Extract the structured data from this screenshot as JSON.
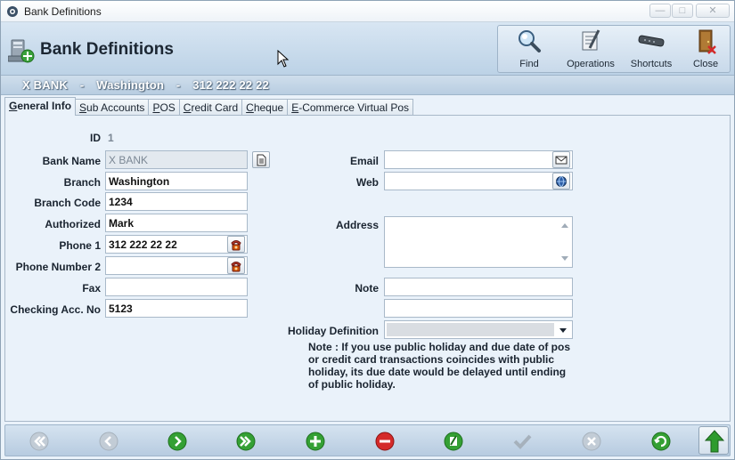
{
  "window": {
    "title": "Bank Definitions"
  },
  "header": {
    "title": "Bank Definitions",
    "toolbar": [
      {
        "label": "Find",
        "icon": "magnifier-icon"
      },
      {
        "label": "Operations",
        "icon": "operations-icon"
      },
      {
        "label": "Shortcuts",
        "icon": "shortcuts-icon"
      },
      {
        "label": "Close",
        "icon": "exit-door-icon"
      }
    ]
  },
  "record": {
    "name": "X BANK",
    "sep1": "-",
    "branch": "Washington",
    "sep2": "-",
    "phone": "312 222 22 22"
  },
  "tabs": [
    {
      "underlined": "G",
      "rest": "eneral Info",
      "active": true
    },
    {
      "underlined": "S",
      "rest": "ub Accounts",
      "active": false
    },
    {
      "underlined": "P",
      "rest": "OS",
      "active": false
    },
    {
      "underlined": "C",
      "rest": "redit Card",
      "active": false
    },
    {
      "underlined": "C",
      "rest": "heque",
      "active": false
    },
    {
      "underlined": "E",
      "rest": "-Commerce Virtual Pos",
      "active": false
    }
  ],
  "form": {
    "id_label": "ID",
    "id_value": "1",
    "bank_name_label": "Bank Name",
    "bank_name_value": "X BANK",
    "branch_label": "Branch",
    "branch_value": "Washington",
    "branch_code_label": "Branch Code",
    "branch_code_value": "1234",
    "authorized_label": "Authorized",
    "authorized_value": "Mark",
    "phone1_label": "Phone 1",
    "phone1_value": "312 222 22 22",
    "phone2_label": "Phone Number 2",
    "phone2_value": "",
    "fax_label": "Fax",
    "fax_value": "",
    "checking_label": "Checking Acc. No",
    "checking_value": "5123",
    "email_label": "Email",
    "email_value": "",
    "web_label": "Web",
    "web_value": "",
    "address_label": "Address",
    "address_value": "",
    "note_label": "Note",
    "note_value1": "",
    "note_value2": "",
    "holiday_label": "Holiday Definition",
    "holiday_value": "",
    "note_text": "Note : If you use public holiday and due date of pos or credit card transactions coincides with public holiday, its due date would be delayed until ending of public holiday."
  },
  "colors": {
    "accent_green": "#2e9b2e",
    "delete_red": "#d42a2a",
    "disabled_gray": "#a6b1bc"
  }
}
